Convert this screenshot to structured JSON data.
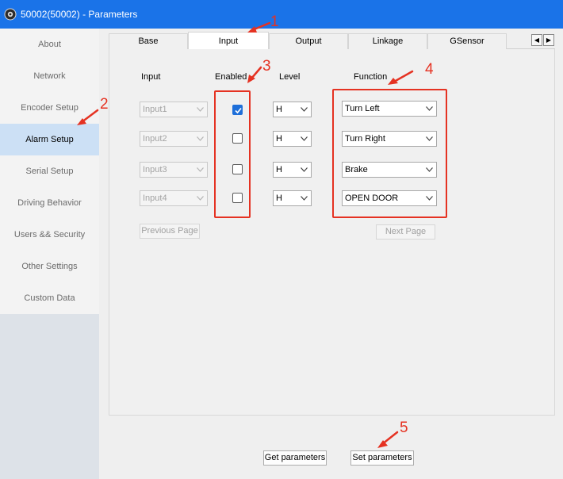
{
  "window": {
    "title": "50002(50002) - Parameters"
  },
  "sidebar": {
    "items": [
      {
        "label": "About"
      },
      {
        "label": "Network"
      },
      {
        "label": "Encoder Setup"
      },
      {
        "label": "Alarm Setup",
        "active": true
      },
      {
        "label": "Serial Setup"
      },
      {
        "label": "Driving Behavior"
      },
      {
        "label": "Users && Security"
      },
      {
        "label": "Other Settings"
      },
      {
        "label": "Custom Data"
      }
    ]
  },
  "tabs": {
    "items": [
      {
        "label": "Base"
      },
      {
        "label": "Input",
        "active": true
      },
      {
        "label": "Output"
      },
      {
        "label": "Linkage"
      },
      {
        "label": "GSensor"
      }
    ],
    "scroll_left": "◀",
    "scroll_right": "▶"
  },
  "table": {
    "headers": {
      "input": "Input",
      "enabled": "Enabled",
      "level": "Level",
      "function": "Function"
    },
    "rows": [
      {
        "input": "Input1",
        "enabled": true,
        "level": "H",
        "function": "Turn Left"
      },
      {
        "input": "Input2",
        "enabled": false,
        "level": "H",
        "function": "Turn Right"
      },
      {
        "input": "Input3",
        "enabled": false,
        "level": "H",
        "function": "Brake"
      },
      {
        "input": "Input4",
        "enabled": false,
        "level": "H",
        "function": "OPEN DOOR"
      }
    ]
  },
  "paging": {
    "previous": "Previous Page",
    "next": "Next Page"
  },
  "actions": {
    "get": "Get parameters",
    "set": "Set parameters"
  },
  "annotations": {
    "n1": "1",
    "n2": "2",
    "n3": "3",
    "n4": "4",
    "n5": "5"
  },
  "colors": {
    "titlebar": "#1a73e8",
    "selected_item": "#cce0f5",
    "checkbox_checked": "#1e6fd9",
    "annotation_red": "#e53222"
  },
  "icons": {
    "app": "app-logo-icon",
    "dropdown": "chevron-down-icon",
    "check": "check-icon",
    "arrow": "arrow-icon"
  }
}
